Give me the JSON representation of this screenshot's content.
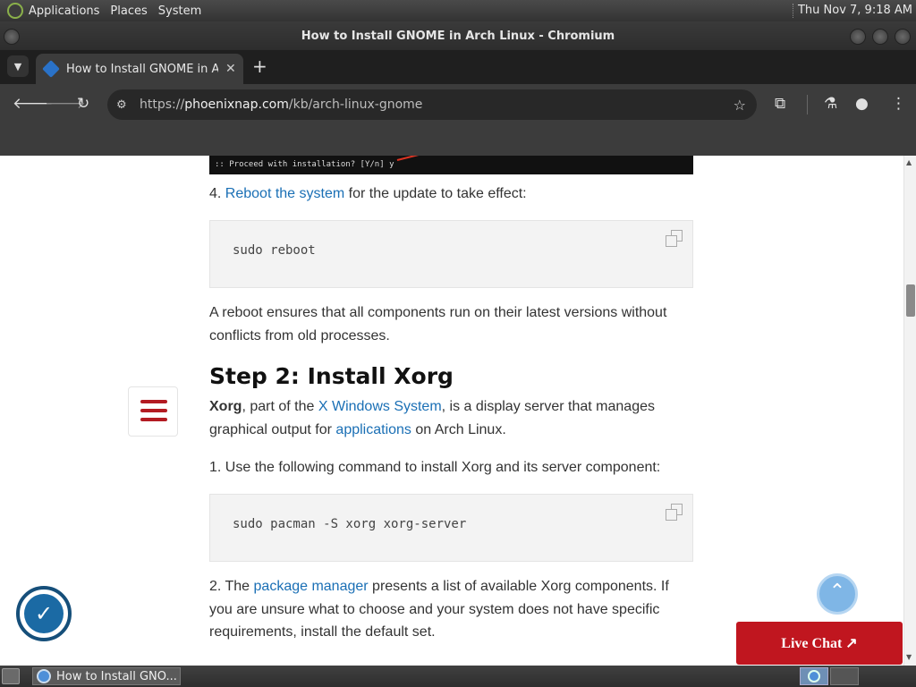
{
  "top_panel": {
    "menus": [
      "Applications",
      "Places",
      "System"
    ],
    "clock": "Thu Nov  7,  9:18 AM"
  },
  "window": {
    "title": "How to Install GNOME in Arch Linux - Chromium"
  },
  "browser": {
    "tab_title": "How to Install GNOME in Arch Linux",
    "tab_close": "✕",
    "new_tab": "+",
    "url_prefix": "https://",
    "url_host": "phoenixnap.com",
    "url_path": "/kb/arch-linux-gnome"
  },
  "article": {
    "terminal_line": ":: Proceed with installation? [Y/n] y",
    "step4_num": "4.",
    "step4_link": "Reboot the system",
    "step4_rest": "for the update to take effect:",
    "code1": "sudo reboot",
    "reboot_note": "A reboot ensures that all components run on their latest versions without conflicts from old processes.",
    "heading": "Step 2: Install Xorg",
    "xorg_bold": "Xorg",
    "xorg_t1": ", part of the ",
    "xorg_link1": "X Windows System",
    "xorg_t2": ", is a display server that manages graphical output for ",
    "xorg_link2": "applications",
    "xorg_t3": " on Arch Linux.",
    "step1": "1. Use the following command to install Xorg and its server component:",
    "code2": "sudo pacman -S xorg xorg-server",
    "step2_a": "2. The ",
    "step2_link": "package manager",
    "step2_b": " presents a list of available Xorg components. If you are unsure what to choose and your system does not have specific requirements, install the default set."
  },
  "widgets": {
    "live_chat": "Live Chat ↗",
    "back_top": "⌃",
    "badge": "✓"
  },
  "taskbar": {
    "task_label": "How to Install GNO..."
  }
}
